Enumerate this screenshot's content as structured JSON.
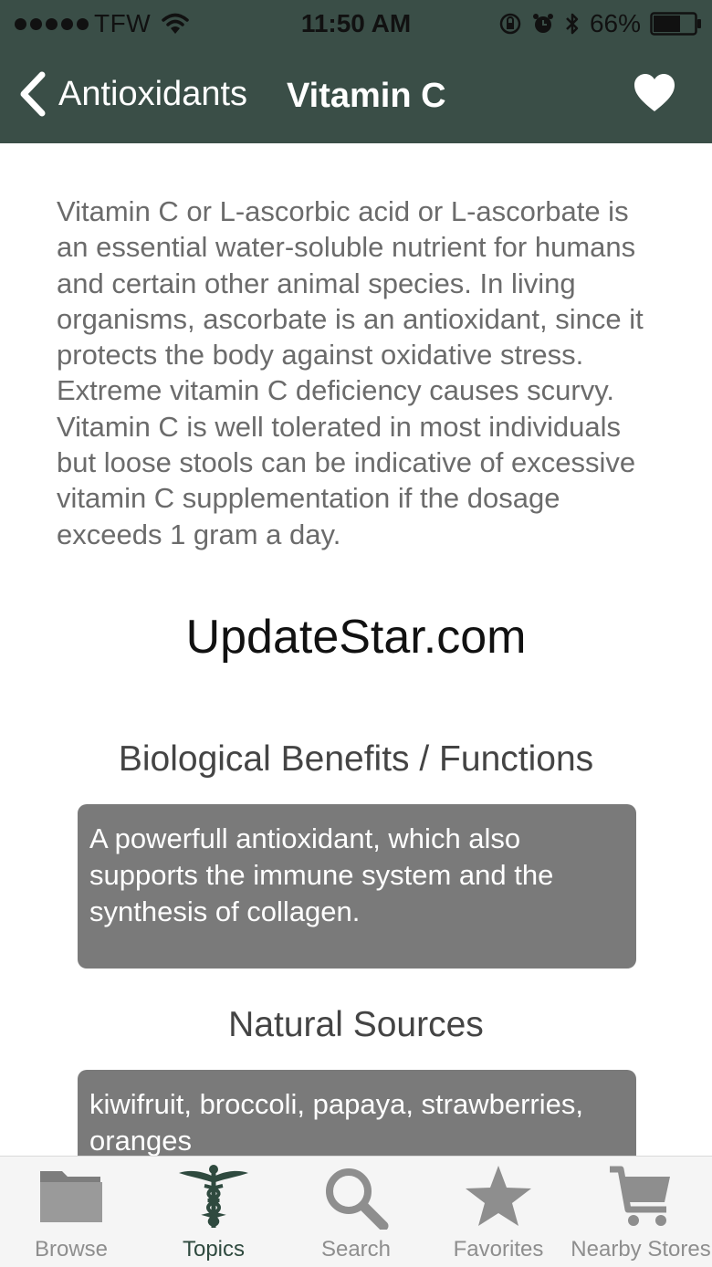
{
  "status_bar": {
    "carrier": "TFW",
    "time": "11:50 AM",
    "battery": "66%",
    "battery_level": 0.66
  },
  "nav": {
    "back_label": "Antioxidants",
    "title": "Vitamin C",
    "favorite_icon": "heart-icon"
  },
  "content": {
    "intro": "Vitamin C or L-ascorbic acid or L-ascorbate is an essential water-soluble nutrient for humans and certain other animal species. In living organisms, ascorbate is an antioxidant, since it protects the body against oxidative stress. Extreme vitamin C deficiency causes scurvy. Vitamin C is well tolerated in most individuals but loose stools can be indicative of excessive vitamin C supplementation if the dosage exceeds 1 gram a day.",
    "watermark": "UpdateStar.com",
    "benefits_title": "Biological Benefits / Functions",
    "benefits_text": "A powerfull antioxidant, which also supports the immune system and the synthesis of collagen.",
    "sources_title": "Natural Sources",
    "sources_text": "kiwifruit, broccoli, papaya, strawberries, oranges"
  },
  "tabbar": {
    "tabs": [
      {
        "label": "Browse",
        "icon": "folder-icon",
        "active": false
      },
      {
        "label": "Topics",
        "icon": "caduceus-icon",
        "active": true
      },
      {
        "label": "Search",
        "icon": "magnifier-icon",
        "active": false
      },
      {
        "label": "Favorites",
        "icon": "star-icon",
        "active": false
      },
      {
        "label": "Nearby Stores",
        "icon": "cart-icon",
        "active": false
      }
    ]
  },
  "colors": {
    "nav_background": "#3a4e47",
    "card_background": "#7a7a7a",
    "active_tab": "#2f4a3f",
    "inactive_tab": "#8e8e8e"
  }
}
